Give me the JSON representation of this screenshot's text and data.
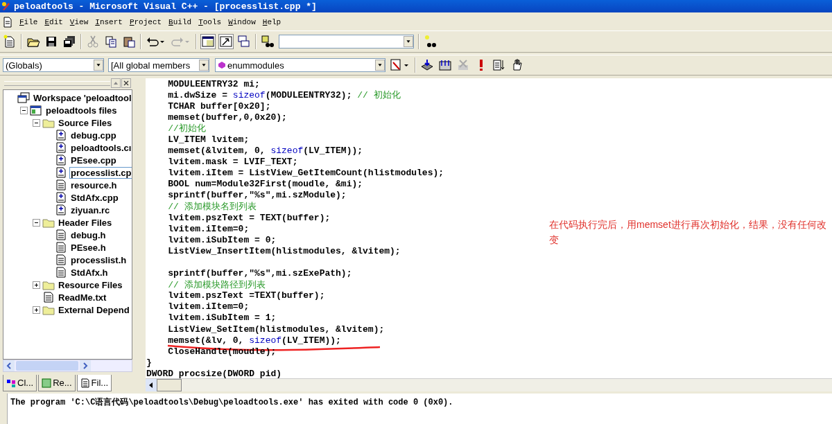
{
  "window": {
    "title": "peloadtools - Microsoft Visual C++ - [processlist.cpp *]"
  },
  "menu": [
    "File",
    "Edit",
    "View",
    "Insert",
    "Project",
    "Build",
    "Tools",
    "Window",
    "Help"
  ],
  "combos": [
    {
      "value": "(Globals)"
    },
    {
      "value": "[All global members"
    },
    {
      "value": "enummodules"
    }
  ],
  "workspace": {
    "tree": [
      {
        "kind": "workspace",
        "label": "Workspace 'peloadtool",
        "selected": false,
        "children": [
          {
            "kind": "project",
            "label": "peloadtools files",
            "expanded": true,
            "selected": false,
            "children": [
              {
                "kind": "folder",
                "label": "Source Files",
                "expanded": true,
                "selected": false,
                "children": [
                  {
                    "kind": "source",
                    "label": "debug.cpp",
                    "selected": false
                  },
                  {
                    "kind": "source",
                    "label": "peloadtools.cı",
                    "selected": false
                  },
                  {
                    "kind": "source",
                    "label": "PEsee.cpp",
                    "selected": false
                  },
                  {
                    "kind": "source",
                    "label": "processlist.cp",
                    "selected": true
                  },
                  {
                    "kind": "text",
                    "label": "resource.h",
                    "selected": false
                  },
                  {
                    "kind": "source",
                    "label": "StdAfx.cpp",
                    "selected": false
                  },
                  {
                    "kind": "source",
                    "label": "ziyuan.rc",
                    "selected": false
                  }
                ]
              },
              {
                "kind": "folder",
                "label": "Header Files",
                "expanded": true,
                "selected": false,
                "children": [
                  {
                    "kind": "text",
                    "label": "debug.h",
                    "selected": false
                  },
                  {
                    "kind": "text",
                    "label": "PEsee.h",
                    "selected": false
                  },
                  {
                    "kind": "text",
                    "label": "processlist.h",
                    "selected": false
                  },
                  {
                    "kind": "text",
                    "label": "StdAfx.h",
                    "selected": false
                  }
                ]
              },
              {
                "kind": "folder",
                "label": "Resource Files",
                "expanded": false,
                "selected": false
              },
              {
                "kind": "text",
                "label": "ReadMe.txt",
                "selected": false
              },
              {
                "kind": "folder",
                "label": "External Depend",
                "expanded": false,
                "selected": false
              }
            ]
          }
        ]
      }
    ],
    "tabs": [
      {
        "label": "Cl...",
        "selected": false
      },
      {
        "label": "Re...",
        "selected": false
      },
      {
        "label": "Fil...",
        "selected": true
      }
    ]
  },
  "editor": {
    "lines": [
      {
        "segments": [
          {
            "kind": "code",
            "text": "    MODULEENTRY32 mi;"
          }
        ]
      },
      {
        "segments": [
          {
            "kind": "code",
            "text": "    mi.dwSize = "
          },
          {
            "kind": "keyword",
            "text": "sizeof"
          },
          {
            "kind": "code",
            "text": "(MODULEENTRY32); "
          },
          {
            "kind": "comment",
            "text": "// 初始化"
          }
        ]
      },
      {
        "segments": [
          {
            "kind": "code",
            "text": "    TCHAR buffer[0x20];"
          }
        ]
      },
      {
        "segments": [
          {
            "kind": "code",
            "text": "    memset(buffer,0,0x20);"
          }
        ]
      },
      {
        "segments": [
          {
            "kind": "comment",
            "text": "    //初始化"
          }
        ]
      },
      {
        "segments": [
          {
            "kind": "code",
            "text": "    LV_ITEM lvitem;"
          }
        ]
      },
      {
        "segments": [
          {
            "kind": "code",
            "text": "    memset(&lvitem, 0, "
          },
          {
            "kind": "keyword",
            "text": "sizeof"
          },
          {
            "kind": "code",
            "text": "(LV_ITEM));"
          }
        ]
      },
      {
        "segments": [
          {
            "kind": "code",
            "text": "    lvitem.mask = LVIF_TEXT;"
          }
        ]
      },
      {
        "segments": [
          {
            "kind": "code",
            "text": "    lvitem.iItem = ListView_GetItemCount(hlistmodules);"
          }
        ]
      },
      {
        "segments": [
          {
            "kind": "code",
            "text": "    BOOL num=Module32First(moudle, &mi);"
          }
        ]
      },
      {
        "segments": [
          {
            "kind": "code",
            "text": "    sprintf(buffer,\"%s\",mi.szModule);"
          }
        ]
      },
      {
        "segments": [
          {
            "kind": "comment",
            "text": "    // 添加模块名到列表"
          }
        ]
      },
      {
        "segments": [
          {
            "kind": "code",
            "text": "    lvitem.pszText = TEXT(buffer);"
          }
        ]
      },
      {
        "segments": [
          {
            "kind": "code",
            "text": "    lvitem.iItem=0;"
          }
        ]
      },
      {
        "segments": [
          {
            "kind": "code",
            "text": "    lvitem.iSubItem = 0;"
          }
        ]
      },
      {
        "segments": [
          {
            "kind": "code",
            "text": "    ListView_InsertItem(hlistmodules, &lvitem);"
          }
        ]
      },
      {
        "gap_before": true,
        "segments": [
          {
            "kind": "code",
            "text": "    sprintf(buffer,\"%s\",mi.szExePath);"
          }
        ]
      },
      {
        "segments": [
          {
            "kind": "comment",
            "text": "    // 添加模块路径到列表"
          }
        ]
      },
      {
        "segments": [
          {
            "kind": "code",
            "text": "    lvitem.pszText =TEXT(buffer);"
          }
        ]
      },
      {
        "segments": [
          {
            "kind": "code",
            "text": "    lvitem.iItem=0;"
          }
        ]
      },
      {
        "segments": [
          {
            "kind": "code",
            "text": "    lvitem.iSubItem = 1;"
          }
        ]
      },
      {
        "segments": [
          {
            "kind": "code",
            "text": "    ListView_SetItem(hlistmodules, &lvitem);"
          }
        ]
      },
      {
        "underlined": true,
        "segments": [
          {
            "kind": "code",
            "text": "    memset(&lv, 0, "
          },
          {
            "kind": "keyword",
            "text": "sizeof"
          },
          {
            "kind": "code",
            "text": "(LV_ITEM));"
          }
        ]
      },
      {
        "segments": [
          {
            "kind": "code",
            "text": "    CloseHandle(moudle);"
          }
        ]
      },
      {
        "segments": [
          {
            "kind": "code",
            "text": "}"
          }
        ]
      },
      {
        "segments": [
          {
            "kind": "code",
            "text": "DWORD procsize(DWORD pid)"
          }
        ]
      }
    ],
    "note": "在代码执行完后，用memset进行再次初始化，结果，没有任何改变"
  },
  "output": {
    "text": "The program 'C:\\C语言代码\\peloadtools\\Debug\\peloadtools.exe' has exited with code 0 (0x0)."
  }
}
